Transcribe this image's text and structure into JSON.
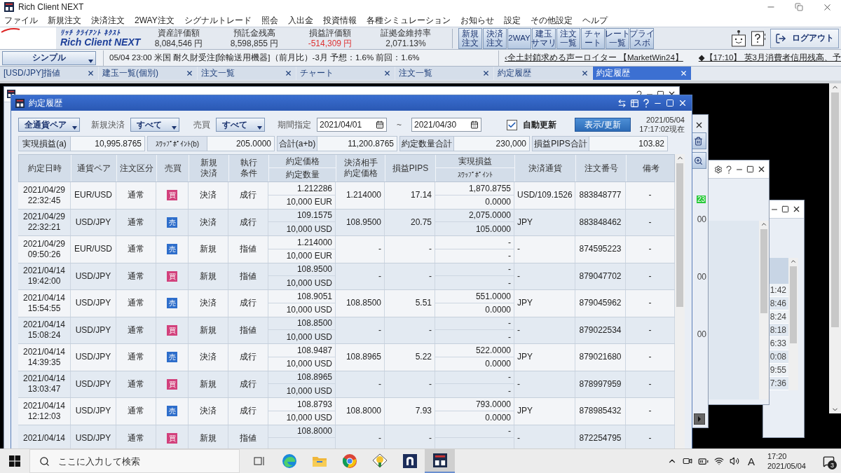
{
  "window": {
    "title": "Rich Client NEXT"
  },
  "menu": [
    "ファイル",
    "新規注文",
    "決済注文",
    "2WAY注文",
    "シグナルトレード",
    "照会",
    "入出金",
    "投資情報",
    "各種シミュレーション",
    "お知らせ",
    "設定",
    "その他設定",
    "ヘルプ"
  ],
  "header": {
    "logo_ruby": "ﾘｯﾁ ｸﾗｲｱﾝﾄ ﾈｸｽﾄ",
    "logo": "Rich Client NEXT",
    "stats": [
      {
        "label": "資産評価額",
        "value": "8,084,546 円",
        "negative": false
      },
      {
        "label": "預託金残高",
        "value": "8,598,855 円",
        "negative": false
      },
      {
        "label": "損益評価額",
        "value": "-514,309 円",
        "negative": true
      },
      {
        "label": "証拠金維持率",
        "value": "2,071.13%",
        "negative": false
      }
    ],
    "toolbar": [
      [
        "新規",
        "注文"
      ],
      [
        "決済",
        "注文"
      ],
      [
        "2WAY"
      ],
      [
        "建玉",
        "サマリ"
      ],
      [
        "注文",
        "一覧"
      ],
      [
        "チャ",
        "ート"
      ],
      [
        "レート",
        "一覧"
      ],
      [
        "プライ",
        "スボ"
      ]
    ],
    "logout": "ログアウト"
  },
  "ticker": {
    "view": "シンプル",
    "news": [
      {
        "text": "05/04 23:00 米国 耐久財受注[除輸送用機器]（前月比）-3月 予想：1.6% 前回：1.6%",
        "link": false
      },
      {
        "text": "‹全土封鎖求める声ーロイター 【MarketWin24】",
        "link": true
      },
      {
        "text": "◆【17:10】 英3月消費者信用残高、予",
        "link": true
      }
    ]
  },
  "tabs": [
    {
      "label": "[USD/JPY]指値",
      "selected": false
    },
    {
      "label": "建玉一覧(個別)",
      "selected": false
    },
    {
      "label": "注文一覧",
      "selected": false
    },
    {
      "label": "チャート",
      "selected": false
    },
    {
      "label": "注文一覧",
      "selected": false
    },
    {
      "label": "約定履歴",
      "selected": false
    },
    {
      "label": "約定履歴",
      "selected": true
    }
  ],
  "dialog": {
    "title": "約定履歴",
    "filters": {
      "pair": "全通貨ペア",
      "new_close_label": "新規決済",
      "new_close": "すべて",
      "side_label": "売買",
      "side": "すべて",
      "period_label": "期間指定",
      "from": "2021/04/01",
      "range_sep": "~",
      "to": "2021/04/30",
      "auto_refresh": {
        "label": "自動更新",
        "checked": true
      },
      "refresh": "表示/更新",
      "as_of": [
        "2021/05/04",
        "17:17:02現在"
      ]
    },
    "summary": [
      {
        "label": "実現損益(a)",
        "value": "10,995.8765"
      },
      {
        "label": "ｽﾜｯﾌﾟﾎﾟｲﾝﾄ(b)",
        "value": "205.0000"
      },
      {
        "label": "合計(a+b)",
        "value": "11,200.8765"
      },
      {
        "label": "約定数量合計",
        "value": "230,000"
      },
      {
        "label": "損益PIPS合計",
        "value": "103.82"
      }
    ],
    "columns": [
      {
        "lines": [
          "約定日時"
        ],
        "split": false
      },
      {
        "lines": [
          "通貨ペア"
        ],
        "split": false
      },
      {
        "lines": [
          "注文区分"
        ],
        "split": false
      },
      {
        "lines": [
          "売買"
        ],
        "split": false
      },
      {
        "lines": [
          "新規",
          "決済"
        ],
        "split": false
      },
      {
        "lines": [
          "執行",
          "条件"
        ],
        "split": false
      },
      {
        "lines": [
          "約定価格",
          "約定数量"
        ],
        "split": true
      },
      {
        "lines": [
          "決済相手",
          "約定価格"
        ],
        "split": false
      },
      {
        "lines": [
          "損益PIPS"
        ],
        "split": false
      },
      {
        "lines": [
          "実現損益",
          "ｽﾜｯﾌﾟﾎﾟｲﾝﾄ"
        ],
        "split": true
      },
      {
        "lines": [
          "決済通貨"
        ],
        "split": false
      },
      {
        "lines": [
          "注文番号"
        ],
        "split": false
      },
      {
        "lines": [
          "備考"
        ],
        "split": false
      }
    ],
    "rows": [
      {
        "date": "2021/04/29",
        "time": "22:32:45",
        "pair": "EUR/USD",
        "type": "通常",
        "side": {
          "label": "買",
          "kind": "buy"
        },
        "action": "決済",
        "cond": "成行",
        "price": "1.212286",
        "qty": "10,000 EUR",
        "counter": "1.214000",
        "pips": "17.14",
        "pl": "1,870.8755",
        "swap": "0.0000",
        "ccy": "USD/109.1526",
        "order_no": "883848777",
        "note": "-"
      },
      {
        "date": "2021/04/29",
        "time": "22:32:21",
        "pair": "USD/JPY",
        "type": "通常",
        "side": {
          "label": "売",
          "kind": "sell"
        },
        "action": "決済",
        "cond": "成行",
        "price": "109.1575",
        "qty": "10,000 USD",
        "counter": "108.9500",
        "pips": "20.75",
        "pl": "2,075.0000",
        "swap": "105.0000",
        "ccy": "JPY",
        "order_no": "883848462",
        "note": "-"
      },
      {
        "date": "2021/04/29",
        "time": "09:50:26",
        "pair": "EUR/USD",
        "type": "通常",
        "side": {
          "label": "売",
          "kind": "sell"
        },
        "action": "新規",
        "cond": "指値",
        "price": "1.214000",
        "qty": "10,000 EUR",
        "counter": "-",
        "pips": "-",
        "pl": "-",
        "swap": "-",
        "ccy": "-",
        "order_no": "874595223",
        "note": "-"
      },
      {
        "date": "2021/04/14",
        "time": "19:42:00",
        "pair": "USD/JPY",
        "type": "通常",
        "side": {
          "label": "買",
          "kind": "buy"
        },
        "action": "新規",
        "cond": "指値",
        "price": "108.9500",
        "qty": "10,000 USD",
        "counter": "-",
        "pips": "-",
        "pl": "-",
        "swap": "-",
        "ccy": "-",
        "order_no": "879047702",
        "note": "-"
      },
      {
        "date": "2021/04/14",
        "time": "15:54:55",
        "pair": "USD/JPY",
        "type": "通常",
        "side": {
          "label": "売",
          "kind": "sell"
        },
        "action": "決済",
        "cond": "成行",
        "price": "108.9051",
        "qty": "10,000 USD",
        "counter": "108.8500",
        "pips": "5.51",
        "pl": "551.0000",
        "swap": "0.0000",
        "ccy": "JPY",
        "order_no": "879045962",
        "note": "-"
      },
      {
        "date": "2021/04/14",
        "time": "15:08:24",
        "pair": "USD/JPY",
        "type": "通常",
        "side": {
          "label": "買",
          "kind": "buy"
        },
        "action": "新規",
        "cond": "指値",
        "price": "108.8500",
        "qty": "10,000 USD",
        "counter": "-",
        "pips": "-",
        "pl": "-",
        "swap": "-",
        "ccy": "-",
        "order_no": "879022534",
        "note": "-"
      },
      {
        "date": "2021/04/14",
        "time": "14:39:35",
        "pair": "USD/JPY",
        "type": "通常",
        "side": {
          "label": "売",
          "kind": "sell"
        },
        "action": "決済",
        "cond": "成行",
        "price": "108.9487",
        "qty": "10,000 USD",
        "counter": "108.8965",
        "pips": "5.22",
        "pl": "522.0000",
        "swap": "0.0000",
        "ccy": "JPY",
        "order_no": "879021680",
        "note": "-"
      },
      {
        "date": "2021/04/14",
        "time": "13:03:47",
        "pair": "USD/JPY",
        "type": "通常",
        "side": {
          "label": "買",
          "kind": "buy"
        },
        "action": "新規",
        "cond": "成行",
        "price": "108.8965",
        "qty": "10,000 USD",
        "counter": "-",
        "pips": "-",
        "pl": "-",
        "swap": "-",
        "ccy": "-",
        "order_no": "878997959",
        "note": "-"
      },
      {
        "date": "2021/04/14",
        "time": "12:12:03",
        "pair": "USD/JPY",
        "type": "通常",
        "side": {
          "label": "売",
          "kind": "sell"
        },
        "action": "決済",
        "cond": "成行",
        "price": "108.8793",
        "qty": "10,000 USD",
        "counter": "108.8000",
        "pips": "7.93",
        "pl": "793.0000",
        "swap": "0.0000",
        "ccy": "JPY",
        "order_no": "878985432",
        "note": "-"
      },
      {
        "date": "2021/04/14",
        "pair": "USD/JPY",
        "type": "通常",
        "side": {
          "label": "買",
          "kind": "buy"
        },
        "action": "新規",
        "cond": "指値",
        "price": "108.8000",
        "counter": "-",
        "pips": "-",
        "pl": "-",
        "ccy": "-",
        "order_no": "872254795",
        "note": "-"
      }
    ]
  },
  "side_windows": {
    "badge": "23",
    "amounts": [
      "00",
      "00",
      "00"
    ],
    "times": [
      "1:42",
      "8:46",
      "8:24",
      "8:18",
      "6:33",
      "0:08",
      "9:55",
      "7:36"
    ]
  },
  "taskbar": {
    "search": {
      "placeholder": "ここに入力して検索"
    },
    "ime": "A",
    "time": "17:20",
    "date": "2021/05/04",
    "notification_count": "3"
  }
}
